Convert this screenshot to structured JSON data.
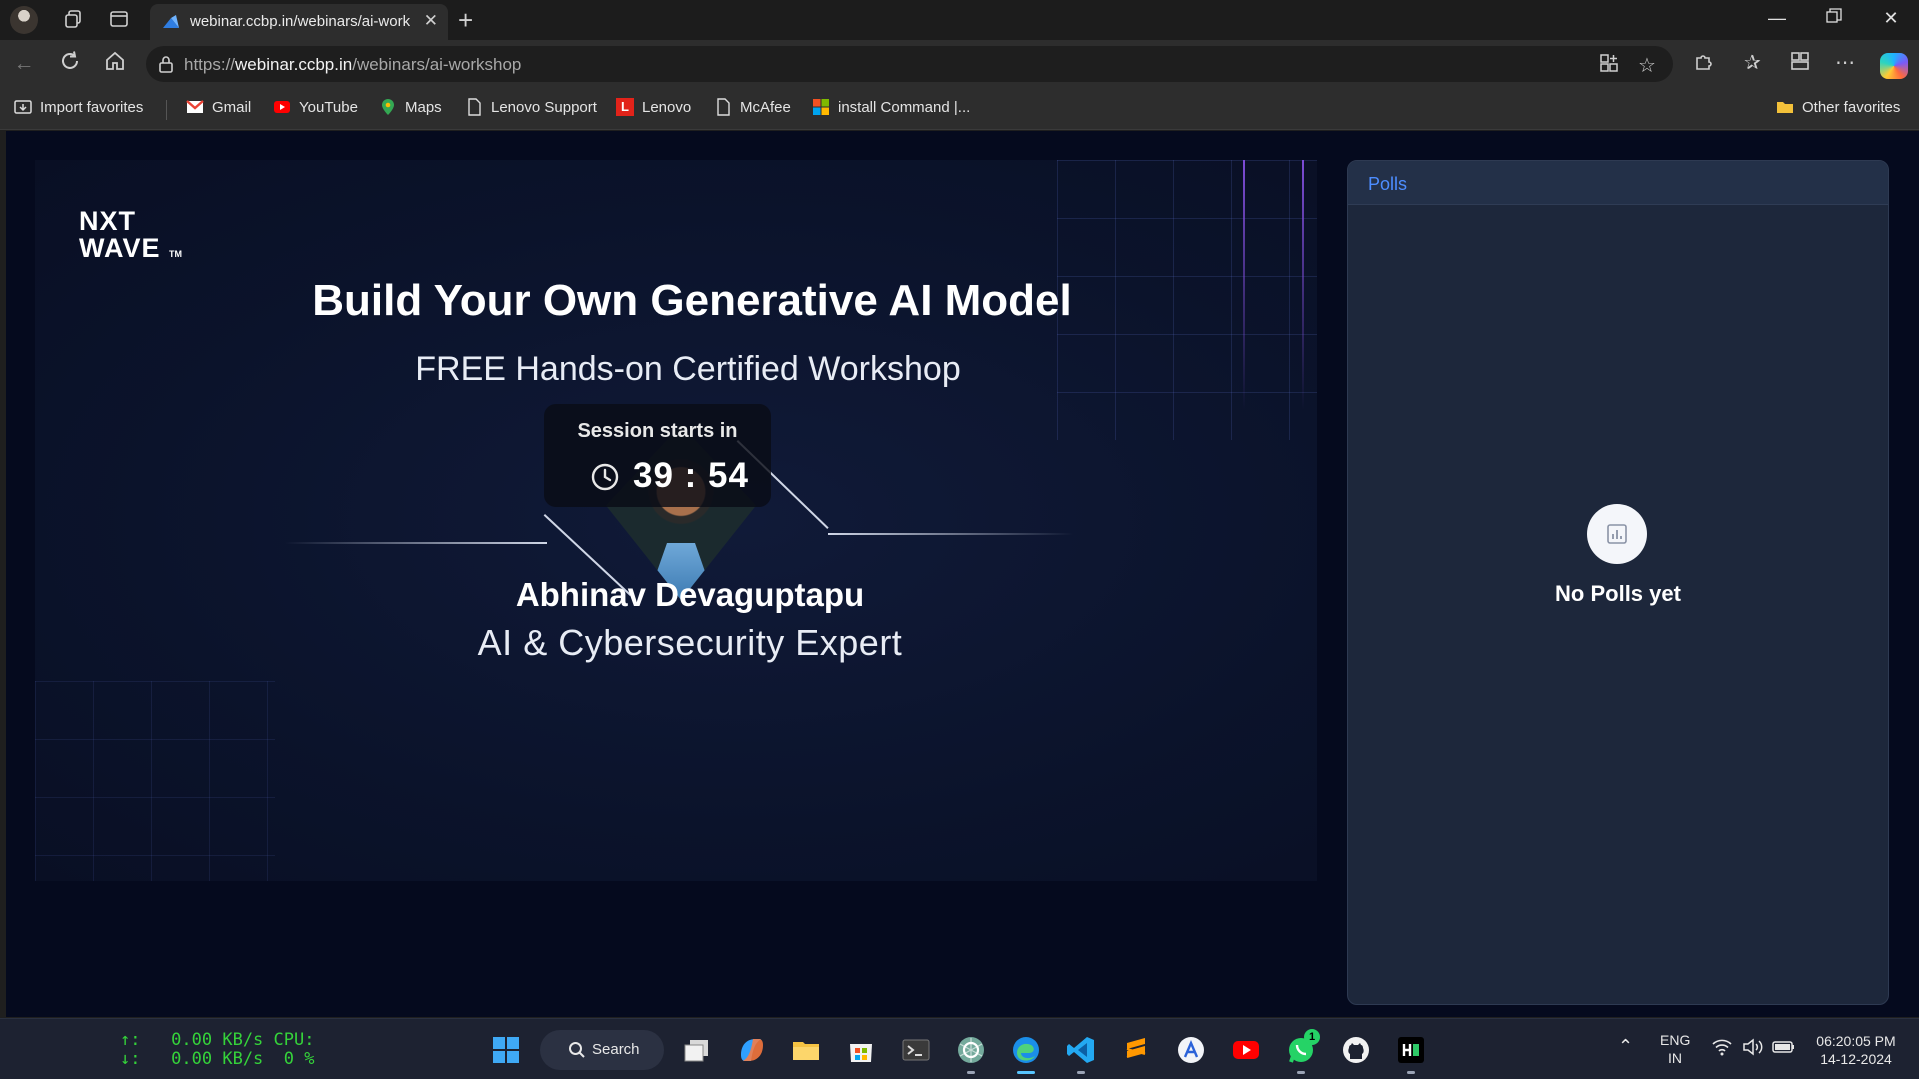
{
  "tab": {
    "title": "webinar.ccbp.in/webinars/ai-workshop"
  },
  "address": {
    "prefix": "https://",
    "domain": "webinar.ccbp.in",
    "path": "/webinars/ai-workshop"
  },
  "favorites": [
    {
      "label": "Import favorites",
      "icon": "import-icon"
    },
    {
      "label": "Gmail",
      "icon": "gmail-icon"
    },
    {
      "label": "YouTube",
      "icon": "youtube-icon"
    },
    {
      "label": "Maps",
      "icon": "maps-icon"
    },
    {
      "label": "Lenovo Support",
      "icon": "page-icon"
    },
    {
      "label": "Lenovo",
      "icon": "lenovo-icon"
    },
    {
      "label": "McAfee",
      "icon": "page-icon"
    },
    {
      "label": "install Command |...",
      "icon": "microsoft-icon"
    }
  ],
  "other_favorites": "Other favorites",
  "hero": {
    "logo_line1": "NXT",
    "logo_line2": "WAVE",
    "logo_tm": "TM",
    "title": "Build Your Own Generative AI Model",
    "subtitle": "FREE Hands-on Certified Workshop",
    "countdown_label": "Session starts in",
    "countdown_time": "39 : 54",
    "speaker_name": "Abhinav Devaguptapu",
    "speaker_role": "AI & Cybersecurity Expert"
  },
  "polls": {
    "title": "Polls",
    "empty_text": "No Polls yet"
  },
  "taskbar": {
    "net_up": "↑:   0.00 KB/s",
    "net_down": "↓:   0.00 KB/s",
    "cpu_label": "CPU:",
    "cpu_value": "0 %",
    "search_label": "Search",
    "lang_line1": "ENG",
    "lang_line2": "IN",
    "time": "06:20:05 PM",
    "date": "14-12-2024",
    "whatsapp_badge": "1"
  },
  "colors": {
    "accent": "#4d8dff",
    "page_bg": "#050a1e",
    "panel_bg": "#1d273b",
    "net_text": "#35d23a"
  }
}
